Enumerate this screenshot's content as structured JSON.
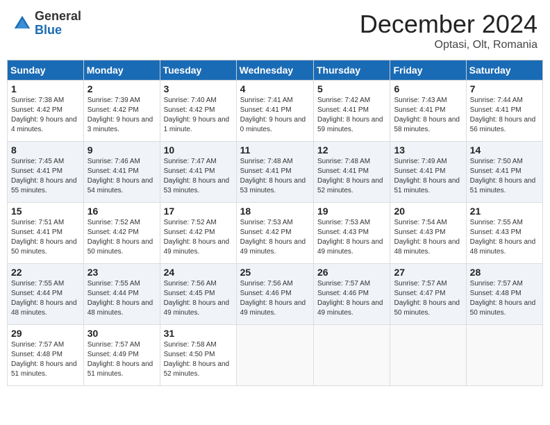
{
  "header": {
    "logo_general": "General",
    "logo_blue": "Blue",
    "month_title": "December 2024",
    "location": "Optasi, Olt, Romania"
  },
  "days_of_week": [
    "Sunday",
    "Monday",
    "Tuesday",
    "Wednesday",
    "Thursday",
    "Friday",
    "Saturday"
  ],
  "weeks": [
    [
      {
        "day": "1",
        "sunrise": "Sunrise: 7:38 AM",
        "sunset": "Sunset: 4:42 PM",
        "daylight": "Daylight: 9 hours and 4 minutes."
      },
      {
        "day": "2",
        "sunrise": "Sunrise: 7:39 AM",
        "sunset": "Sunset: 4:42 PM",
        "daylight": "Daylight: 9 hours and 3 minutes."
      },
      {
        "day": "3",
        "sunrise": "Sunrise: 7:40 AM",
        "sunset": "Sunset: 4:42 PM",
        "daylight": "Daylight: 9 hours and 1 minute."
      },
      {
        "day": "4",
        "sunrise": "Sunrise: 7:41 AM",
        "sunset": "Sunset: 4:41 PM",
        "daylight": "Daylight: 9 hours and 0 minutes."
      },
      {
        "day": "5",
        "sunrise": "Sunrise: 7:42 AM",
        "sunset": "Sunset: 4:41 PM",
        "daylight": "Daylight: 8 hours and 59 minutes."
      },
      {
        "day": "6",
        "sunrise": "Sunrise: 7:43 AM",
        "sunset": "Sunset: 4:41 PM",
        "daylight": "Daylight: 8 hours and 58 minutes."
      },
      {
        "day": "7",
        "sunrise": "Sunrise: 7:44 AM",
        "sunset": "Sunset: 4:41 PM",
        "daylight": "Daylight: 8 hours and 56 minutes."
      }
    ],
    [
      {
        "day": "8",
        "sunrise": "Sunrise: 7:45 AM",
        "sunset": "Sunset: 4:41 PM",
        "daylight": "Daylight: 8 hours and 55 minutes."
      },
      {
        "day": "9",
        "sunrise": "Sunrise: 7:46 AM",
        "sunset": "Sunset: 4:41 PM",
        "daylight": "Daylight: 8 hours and 54 minutes."
      },
      {
        "day": "10",
        "sunrise": "Sunrise: 7:47 AM",
        "sunset": "Sunset: 4:41 PM",
        "daylight": "Daylight: 8 hours and 53 minutes."
      },
      {
        "day": "11",
        "sunrise": "Sunrise: 7:48 AM",
        "sunset": "Sunset: 4:41 PM",
        "daylight": "Daylight: 8 hours and 53 minutes."
      },
      {
        "day": "12",
        "sunrise": "Sunrise: 7:48 AM",
        "sunset": "Sunset: 4:41 PM",
        "daylight": "Daylight: 8 hours and 52 minutes."
      },
      {
        "day": "13",
        "sunrise": "Sunrise: 7:49 AM",
        "sunset": "Sunset: 4:41 PM",
        "daylight": "Daylight: 8 hours and 51 minutes."
      },
      {
        "day": "14",
        "sunrise": "Sunrise: 7:50 AM",
        "sunset": "Sunset: 4:41 PM",
        "daylight": "Daylight: 8 hours and 51 minutes."
      }
    ],
    [
      {
        "day": "15",
        "sunrise": "Sunrise: 7:51 AM",
        "sunset": "Sunset: 4:41 PM",
        "daylight": "Daylight: 8 hours and 50 minutes."
      },
      {
        "day": "16",
        "sunrise": "Sunrise: 7:52 AM",
        "sunset": "Sunset: 4:42 PM",
        "daylight": "Daylight: 8 hours and 50 minutes."
      },
      {
        "day": "17",
        "sunrise": "Sunrise: 7:52 AM",
        "sunset": "Sunset: 4:42 PM",
        "daylight": "Daylight: 8 hours and 49 minutes."
      },
      {
        "day": "18",
        "sunrise": "Sunrise: 7:53 AM",
        "sunset": "Sunset: 4:42 PM",
        "daylight": "Daylight: 8 hours and 49 minutes."
      },
      {
        "day": "19",
        "sunrise": "Sunrise: 7:53 AM",
        "sunset": "Sunset: 4:43 PM",
        "daylight": "Daylight: 8 hours and 49 minutes."
      },
      {
        "day": "20",
        "sunrise": "Sunrise: 7:54 AM",
        "sunset": "Sunset: 4:43 PM",
        "daylight": "Daylight: 8 hours and 48 minutes."
      },
      {
        "day": "21",
        "sunrise": "Sunrise: 7:55 AM",
        "sunset": "Sunset: 4:43 PM",
        "daylight": "Daylight: 8 hours and 48 minutes."
      }
    ],
    [
      {
        "day": "22",
        "sunrise": "Sunrise: 7:55 AM",
        "sunset": "Sunset: 4:44 PM",
        "daylight": "Daylight: 8 hours and 48 minutes."
      },
      {
        "day": "23",
        "sunrise": "Sunrise: 7:55 AM",
        "sunset": "Sunset: 4:44 PM",
        "daylight": "Daylight: 8 hours and 48 minutes."
      },
      {
        "day": "24",
        "sunrise": "Sunrise: 7:56 AM",
        "sunset": "Sunset: 4:45 PM",
        "daylight": "Daylight: 8 hours and 49 minutes."
      },
      {
        "day": "25",
        "sunrise": "Sunrise: 7:56 AM",
        "sunset": "Sunset: 4:46 PM",
        "daylight": "Daylight: 8 hours and 49 minutes."
      },
      {
        "day": "26",
        "sunrise": "Sunrise: 7:57 AM",
        "sunset": "Sunset: 4:46 PM",
        "daylight": "Daylight: 8 hours and 49 minutes."
      },
      {
        "day": "27",
        "sunrise": "Sunrise: 7:57 AM",
        "sunset": "Sunset: 4:47 PM",
        "daylight": "Daylight: 8 hours and 50 minutes."
      },
      {
        "day": "28",
        "sunrise": "Sunrise: 7:57 AM",
        "sunset": "Sunset: 4:48 PM",
        "daylight": "Daylight: 8 hours and 50 minutes."
      }
    ],
    [
      {
        "day": "29",
        "sunrise": "Sunrise: 7:57 AM",
        "sunset": "Sunset: 4:48 PM",
        "daylight": "Daylight: 8 hours and 51 minutes."
      },
      {
        "day": "30",
        "sunrise": "Sunrise: 7:57 AM",
        "sunset": "Sunset: 4:49 PM",
        "daylight": "Daylight: 8 hours and 51 minutes."
      },
      {
        "day": "31",
        "sunrise": "Sunrise: 7:58 AM",
        "sunset": "Sunset: 4:50 PM",
        "daylight": "Daylight: 8 hours and 52 minutes."
      },
      null,
      null,
      null,
      null
    ]
  ]
}
